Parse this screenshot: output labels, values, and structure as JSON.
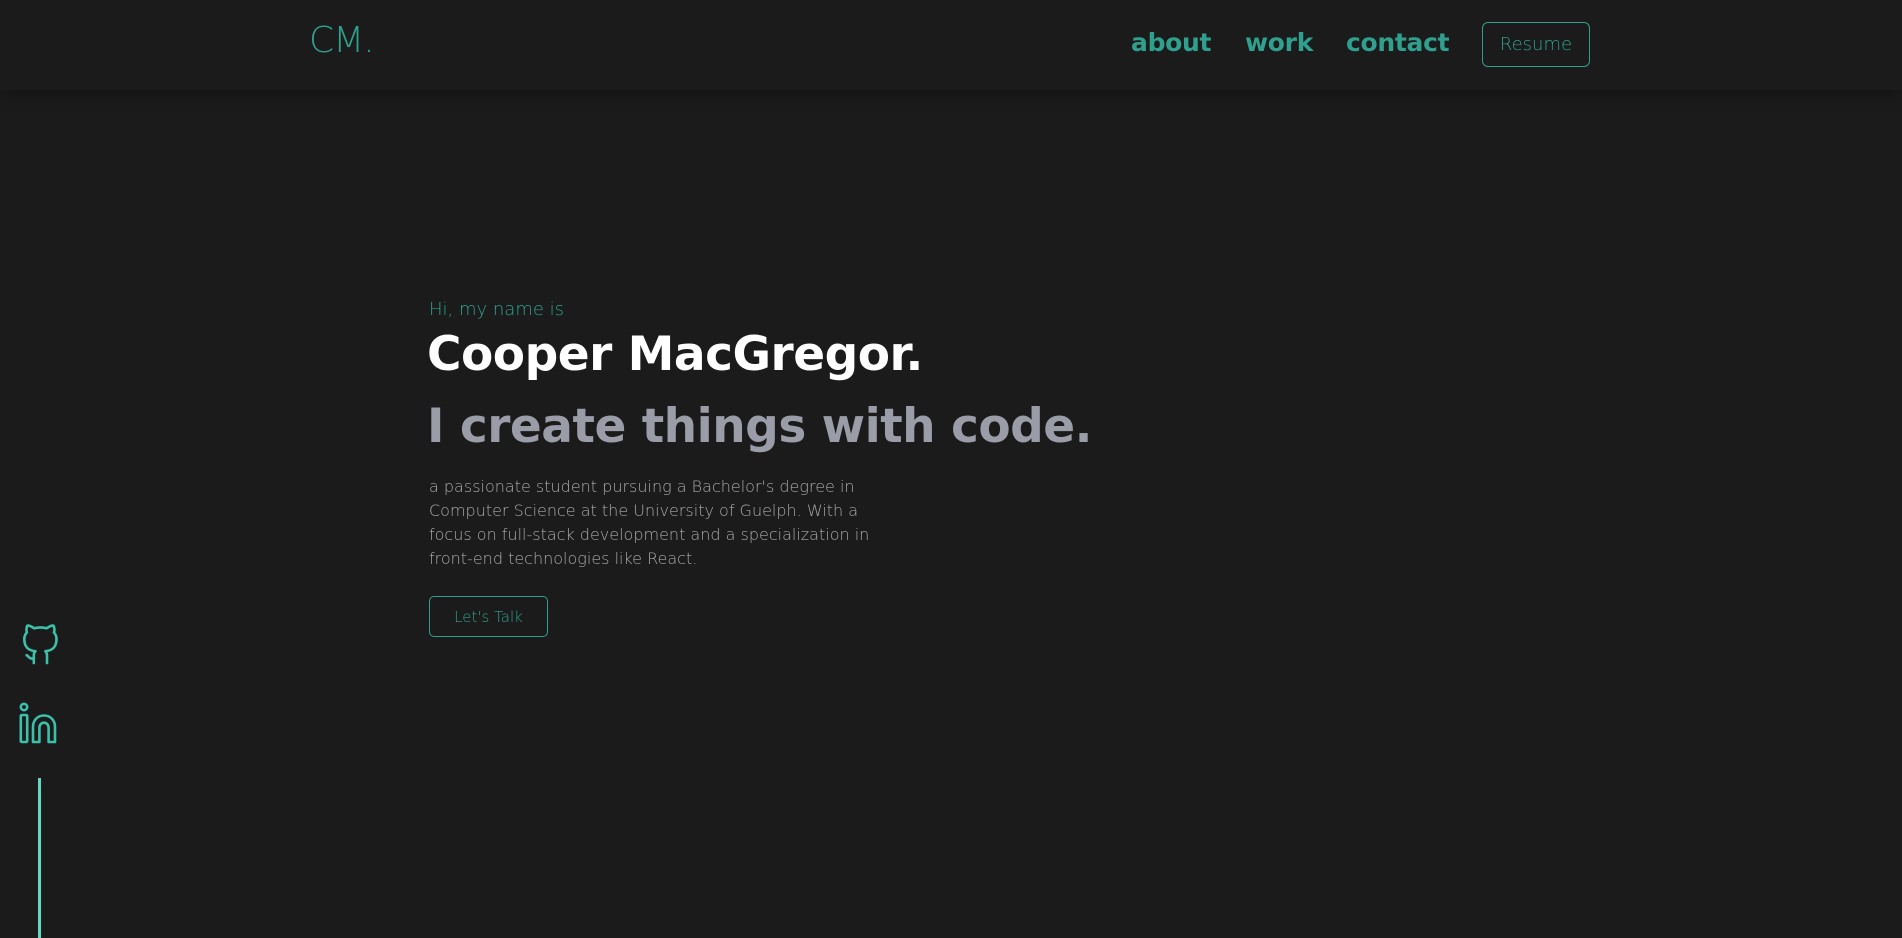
{
  "colors": {
    "background": "#1b1b1b",
    "accent": "#2fa08d",
    "heading": "#ffffff",
    "subheading": "#9a9ca8",
    "body_text": "#a9a9ab",
    "side_line": "#5fd8c4"
  },
  "header": {
    "logo": "CM.",
    "nav": {
      "about": "about",
      "work": "work",
      "contact": "contact"
    },
    "resume_label": "Resume"
  },
  "hero": {
    "greeting": "Hi, my name is",
    "name": "Cooper MacGregor.",
    "tagline": "I create things with code.",
    "description": "a passionate student pursuing a Bachelor's degree in Computer Science at the University of Guelph. With a focus on full-stack development and a specialization in front-end technologies like React.",
    "cta_label": "Let's Talk"
  },
  "social": {
    "icons": [
      "github-icon",
      "linkedin-icon"
    ]
  }
}
